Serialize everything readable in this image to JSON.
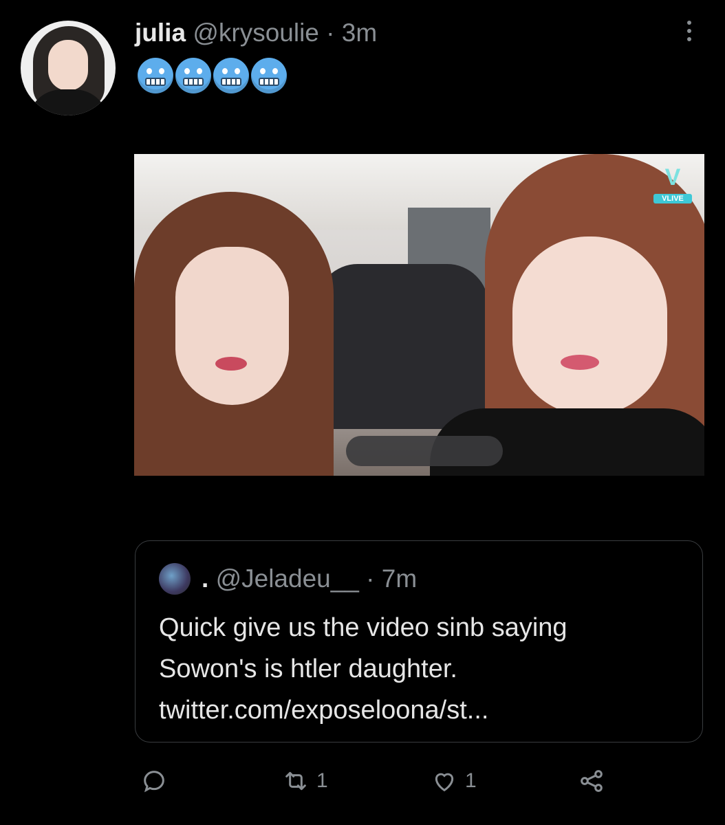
{
  "tweet": {
    "display_name": "julia",
    "handle": "@krysoulie",
    "separator": "·",
    "time": "3m",
    "text_emojis": [
      "cold-face-emoji",
      "cold-face-emoji",
      "cold-face-emoji",
      "cold-face-emoji"
    ]
  },
  "media": {
    "watermark": "VLIVE"
  },
  "quoted_tweet": {
    "display_name": ".",
    "handle": "@Jeladeu__",
    "separator": "·",
    "time": "7m",
    "text_lines": [
      "Quick give us the video sinb saying",
      "Sowon's is htler daughter.",
      "twitter.com/exposeloona/st..."
    ]
  },
  "actions": {
    "reply_icon": "reply-icon",
    "retweet_icon": "retweet-icon",
    "retweet_count": "1",
    "like_icon": "heart-icon",
    "like_count": "1",
    "share_icon": "share-icon"
  }
}
